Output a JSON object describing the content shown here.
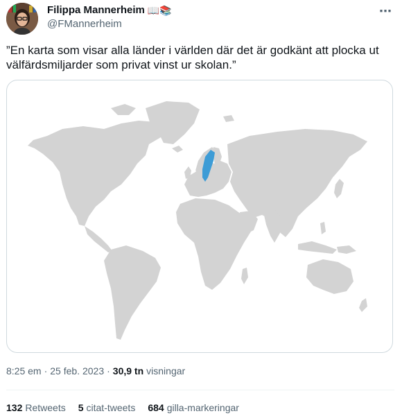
{
  "author": {
    "name": "Filippa Mannerheim",
    "name_emoji": "📖📚",
    "handle": "@FMannerheim"
  },
  "more_icon": "⋯",
  "tweet": {
    "text": "”En karta som visar alla länder i världen där det är godkänt att plocka ut välfärdsmiljarder som privat vinst ur skolan.”"
  },
  "media": {
    "alt": "world-map",
    "land_color": "#d3d3d3",
    "highlight_color": "#3d9cd6"
  },
  "meta": {
    "time": "8:25 em",
    "separator1": "·",
    "date": "25 feb. 2023",
    "separator2": "·",
    "views_count": "30,9 tn",
    "views_label": "visningar"
  },
  "stats": {
    "retweets_count": "132",
    "retweets_label": "Retweets",
    "quotes_count": "5",
    "quotes_label": "citat-tweets",
    "likes_count": "684",
    "likes_label": "gilla-markeringar"
  }
}
